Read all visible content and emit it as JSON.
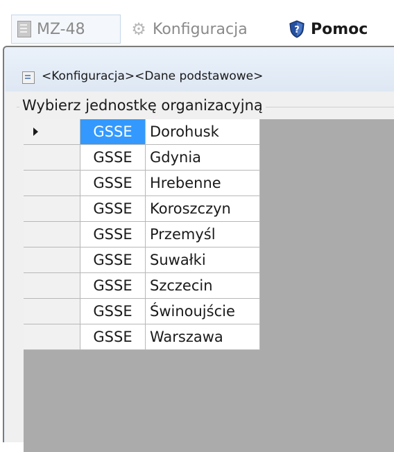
{
  "menubar": {
    "items": [
      {
        "label": "MZ-48",
        "icon": "document-icon",
        "enabled": false
      },
      {
        "label": "Konfiguracja",
        "icon": "gear-icon",
        "enabled": false
      },
      {
        "label": "Pomoc",
        "icon": "help-shield-icon",
        "enabled": true
      }
    ]
  },
  "window": {
    "title": "<Konfiguracja><Dane podstawowe>",
    "group_caption": "Wybierz jednostkę organizacyjną",
    "grid": {
      "current_row": 0,
      "rows": [
        {
          "code": "GSSE",
          "name": "Dorohusk"
        },
        {
          "code": "GSSE",
          "name": "Gdynia"
        },
        {
          "code": "GSSE",
          "name": "Hrebenne"
        },
        {
          "code": "GSSE",
          "name": "Koroszczyn"
        },
        {
          "code": "GSSE",
          "name": "Przemyśl"
        },
        {
          "code": "GSSE",
          "name": "Suwałki"
        },
        {
          "code": "GSSE",
          "name": "Szczecin"
        },
        {
          "code": "GSSE",
          "name": "Świnoujście"
        },
        {
          "code": "GSSE",
          "name": "Warszawa"
        }
      ]
    }
  },
  "colors": {
    "selection": "#3399ff",
    "grid_background": "#ababab",
    "title_gradient_top": "#eaf1fa"
  }
}
